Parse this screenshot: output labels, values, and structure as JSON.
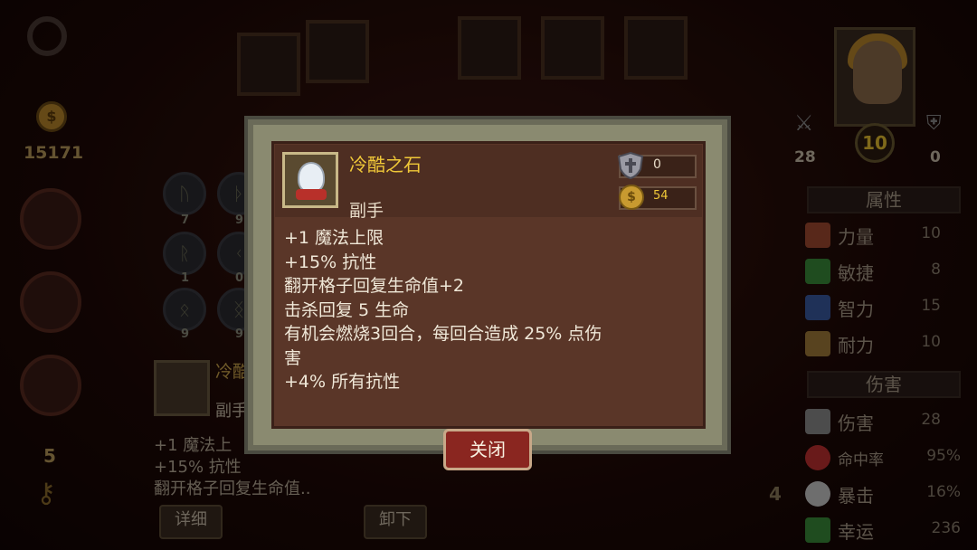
{
  "player": {
    "gold": "15171",
    "keys": "5",
    "level": "10",
    "attack": "28",
    "defense": "0"
  },
  "skills": [
    {
      "num": "7"
    },
    {
      "num": "9"
    },
    {
      "num": "1"
    },
    {
      "num": "0"
    },
    {
      "num": "9"
    },
    {
      "num": "9"
    }
  ],
  "background_item": {
    "name": "冷酷",
    "type": "副手",
    "lines": [
      "+1 魔法上",
      "+15% 抗性",
      "翻开格子回复生命值.."
    ],
    "details_button": "详细",
    "unequip_button": "卸下"
  },
  "attributes": {
    "header": "属性",
    "items": [
      {
        "label": "力量",
        "value": "10",
        "color": "#a04a30"
      },
      {
        "label": "敏捷",
        "value": "8",
        "color": "#3a8a3a"
      },
      {
        "label": "智力",
        "value": "15",
        "color": "#3a5aa0"
      },
      {
        "label": "耐力",
        "value": "10",
        "color": "#a07a3a"
      }
    ]
  },
  "damage": {
    "header": "伤害",
    "items": [
      {
        "label": "伤害",
        "value": "28",
        "color": "#8a8a8a"
      },
      {
        "label": "命中率",
        "value": "95%",
        "color": "#c03030"
      },
      {
        "label": "暴击",
        "value": "16%",
        "color": "#c8c8c8"
      },
      {
        "label": "幸运",
        "value": "236",
        "color": "#3a8a3a"
      }
    ]
  },
  "modal": {
    "item_name": "冷酷之石",
    "item_type": "副手",
    "armor": "0",
    "price": "54",
    "effects": [
      "+1 魔法上限",
      "+15% 抗性",
      "翻开格子回复生命值+2",
      "击杀回复 5 生命",
      "有机会燃烧3回合，每回合造成 25% 点伤",
      "害",
      "+4% 所有抗性"
    ],
    "close_label": "关闭"
  },
  "side_numbers": {
    "left_mid": "4"
  }
}
